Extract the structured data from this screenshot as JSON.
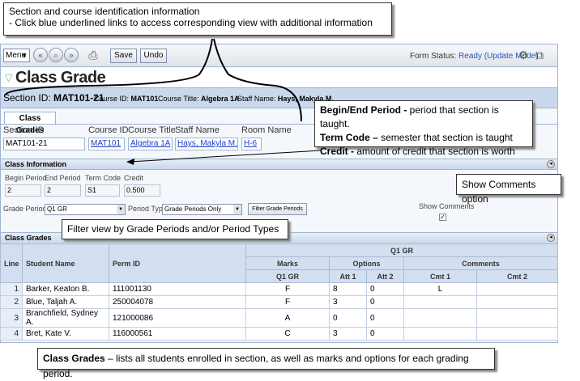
{
  "callouts": {
    "section_info_title": "Section and course identification information",
    "section_info_detail": " - Click blue underlined  links to access corresponding  view with additional information",
    "period_label": "Begin/End Period -",
    "period_text": " period that section is taught.",
    "term_label": "Term Code –",
    "term_text": " semester that section is taught",
    "credit_label": "Credit -",
    "credit_text": " amount of credit that section is worth",
    "show_comments": "Show Comments  option",
    "filter": "Filter view by Grade Periods and/or Period Types",
    "class_grades_label": "Class Grades",
    "class_grades_text": " – lists all students enrolled in section, as well as marks and options for each grading period."
  },
  "toolbar": {
    "menu_label": "Menu",
    "save_label": "Save",
    "undo_label": "Undo",
    "form_status_label": "Form Status:",
    "form_status_value": "Ready (Update Mode)"
  },
  "page": {
    "title": "Class Grade"
  },
  "section_band": {
    "section_id_label": "Section ID:",
    "section_id_value": "MAT101-21",
    "course_id_label": "Course ID:",
    "course_id_value": "MAT101",
    "course_title_label": "Course Title:",
    "course_title_value": "Algebra 1A",
    "staff_name_label": "Staff Name:",
    "staff_name_value": "Hays, Makyla M."
  },
  "tab": {
    "label": "Class Grades"
  },
  "fields": {
    "section_id_label": "Section ID",
    "section_id_value": "MAT101-21",
    "course_id_label": "Course ID",
    "course_id_value": "MAT101",
    "course_title_label": "Course Title",
    "course_title_value": "Algebra 1A",
    "staff_name_label": "Staff Name",
    "staff_name_value": "Hays, Makyla M.",
    "room_name_label": "Room Name",
    "room_name_value": "H-6"
  },
  "class_info": {
    "header": "Class Information",
    "begin_period_label": "Begin Period",
    "begin_period_value": "2",
    "end_period_label": "End Period",
    "end_period_value": "2",
    "term_code_label": "Term Code",
    "term_code_value": "S1",
    "credit_label": "Credit",
    "credit_value": "0.500"
  },
  "filters": {
    "grade_periods_label": "Grade Periods",
    "grade_periods_value": "Q1 GR",
    "period_type_label": "Period Type",
    "period_type_value": "Grade Periods Only",
    "filter_button": "Filter Grade Periods",
    "show_comments_label": "Show Comments",
    "show_comments_checked": "✓"
  },
  "grades": {
    "header": "Class Grades",
    "col_line": "Line",
    "col_student": "Student Name",
    "col_perm": "Perm ID",
    "period": "Q1 GR",
    "marks": "Marks",
    "options": "Options",
    "comments": "Comments",
    "sub_mark": "Q1 GR",
    "sub_att1": "Att 1",
    "sub_att2": "Att 2",
    "sub_cmt1": "Cmt 1",
    "sub_cmt2": "Cmt 2",
    "rows": [
      {
        "line": "1",
        "name": "Barker, Keaton B.",
        "perm": "111001130",
        "mark": "F",
        "att1": "8",
        "att2": "0",
        "cmt1": "L",
        "cmt2": ""
      },
      {
        "line": "2",
        "name": "Blue, Taljah A.",
        "perm": "250004078",
        "mark": "F",
        "att1": "3",
        "att2": "0",
        "cmt1": "",
        "cmt2": ""
      },
      {
        "line": "3",
        "name": "Branchfield, Sydney A.",
        "perm": "121000086",
        "mark": "A",
        "att1": "0",
        "att2": "0",
        "cmt1": "",
        "cmt2": ""
      },
      {
        "line": "4",
        "name": "Bret, Kate V.",
        "perm": "116000561",
        "mark": "C",
        "att1": "3",
        "att2": "0",
        "cmt1": "",
        "cmt2": ""
      }
    ]
  }
}
